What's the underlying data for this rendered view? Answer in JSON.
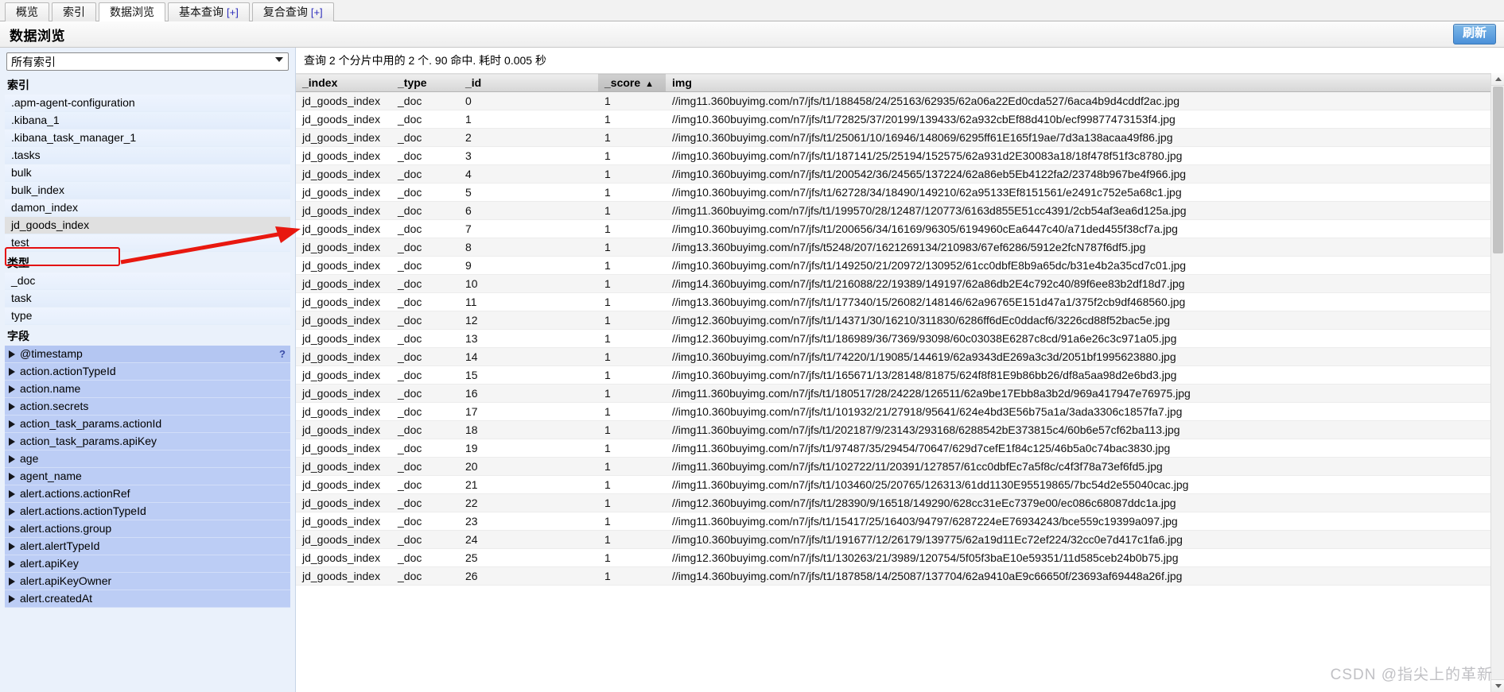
{
  "tabs": [
    {
      "label": "概览",
      "active": false,
      "plus": ""
    },
    {
      "label": "索引",
      "active": false,
      "plus": ""
    },
    {
      "label": "数据浏览",
      "active": true,
      "plus": ""
    },
    {
      "label": "基本查询",
      "active": false,
      "plus": "[+]"
    },
    {
      "label": "复合查询",
      "active": false,
      "plus": "[+]"
    }
  ],
  "header": {
    "title": "数据浏览",
    "refresh_label": "刷新"
  },
  "sidebar": {
    "index_select_value": "所有索引",
    "index_select_options": [
      "所有索引"
    ],
    "indices_title": "索引",
    "indices": [
      {
        "label": ".apm-agent-configuration",
        "selected": false
      },
      {
        "label": ".kibana_1",
        "selected": false
      },
      {
        "label": ".kibana_task_manager_1",
        "selected": false
      },
      {
        "label": ".tasks",
        "selected": false
      },
      {
        "label": "bulk",
        "selected": false
      },
      {
        "label": "bulk_index",
        "selected": false
      },
      {
        "label": "damon_index",
        "selected": false
      },
      {
        "label": "jd_goods_index",
        "selected": true
      },
      {
        "label": "test",
        "selected": false
      }
    ],
    "types_title": "类型",
    "types": [
      {
        "label": "_doc"
      },
      {
        "label": "task"
      },
      {
        "label": "type"
      }
    ],
    "fields_title": "字段",
    "fields": [
      {
        "label": "@timestamp",
        "help": "?"
      },
      {
        "label": "action.actionTypeId",
        "help": ""
      },
      {
        "label": "action.name",
        "help": ""
      },
      {
        "label": "action.secrets",
        "help": ""
      },
      {
        "label": "action_task_params.actionId",
        "help": ""
      },
      {
        "label": "action_task_params.apiKey",
        "help": ""
      },
      {
        "label": "age",
        "help": ""
      },
      {
        "label": "agent_name",
        "help": ""
      },
      {
        "label": "alert.actions.actionRef",
        "help": ""
      },
      {
        "label": "alert.actions.actionTypeId",
        "help": ""
      },
      {
        "label": "alert.actions.group",
        "help": ""
      },
      {
        "label": "alert.alertTypeId",
        "help": ""
      },
      {
        "label": "alert.apiKey",
        "help": ""
      },
      {
        "label": "alert.apiKeyOwner",
        "help": ""
      },
      {
        "label": "alert.createdAt",
        "help": ""
      }
    ]
  },
  "main": {
    "query_status": "查询 2 个分片中用的 2 个. 90 命中. 耗时 0.005 秒",
    "columns": [
      {
        "key": "_index",
        "label": "_index",
        "sorted": false,
        "sort_arrow": ""
      },
      {
        "key": "_type",
        "label": "_type",
        "sorted": false,
        "sort_arrow": ""
      },
      {
        "key": "_id",
        "label": "_id",
        "sorted": false,
        "sort_arrow": ""
      },
      {
        "key": "_score",
        "label": "_score",
        "sorted": true,
        "sort_arrow": "▲"
      },
      {
        "key": "img",
        "label": "img",
        "sorted": false,
        "sort_arrow": ""
      }
    ],
    "rows": [
      {
        "_index": "jd_goods_index",
        "_type": "_doc",
        "_id": "0",
        "_score": "1",
        "img": "//img11.360buyimg.com/n7/jfs/t1/188458/24/25163/62935/62a06a22Ed0cda527/6aca4b9d4cddf2ac.jpg"
      },
      {
        "_index": "jd_goods_index",
        "_type": "_doc",
        "_id": "1",
        "_score": "1",
        "img": "//img10.360buyimg.com/n7/jfs/t1/72825/37/20199/139433/62a932cbEf88d410b/ecf99877473153f4.jpg"
      },
      {
        "_index": "jd_goods_index",
        "_type": "_doc",
        "_id": "2",
        "_score": "1",
        "img": "//img10.360buyimg.com/n7/jfs/t1/25061/10/16946/148069/6295ff61E165f19ae/7d3a138acaa49f86.jpg"
      },
      {
        "_index": "jd_goods_index",
        "_type": "_doc",
        "_id": "3",
        "_score": "1",
        "img": "//img10.360buyimg.com/n7/jfs/t1/187141/25/25194/152575/62a931d2E30083a18/18f478f51f3c8780.jpg"
      },
      {
        "_index": "jd_goods_index",
        "_type": "_doc",
        "_id": "4",
        "_score": "1",
        "img": "//img10.360buyimg.com/n7/jfs/t1/200542/36/24565/137224/62a86eb5Eb4122fa2/23748b967be4f966.jpg"
      },
      {
        "_index": "jd_goods_index",
        "_type": "_doc",
        "_id": "5",
        "_score": "1",
        "img": "//img10.360buyimg.com/n7/jfs/t1/62728/34/18490/149210/62a95133Ef8151561/e2491c752e5a68c1.jpg"
      },
      {
        "_index": "jd_goods_index",
        "_type": "_doc",
        "_id": "6",
        "_score": "1",
        "img": "//img11.360buyimg.com/n7/jfs/t1/199570/28/12487/120773/6163d855E51cc4391/2cb54af3ea6d125a.jpg"
      },
      {
        "_index": "jd_goods_index",
        "_type": "_doc",
        "_id": "7",
        "_score": "1",
        "img": "//img10.360buyimg.com/n7/jfs/t1/200656/34/16169/96305/6194960cEa6447c40/a71ded455f38cf7a.jpg"
      },
      {
        "_index": "jd_goods_index",
        "_type": "_doc",
        "_id": "8",
        "_score": "1",
        "img": "//img13.360buyimg.com/n7/jfs/t5248/207/1621269134/210983/67ef6286/5912e2fcN787f6df5.jpg"
      },
      {
        "_index": "jd_goods_index",
        "_type": "_doc",
        "_id": "9",
        "_score": "1",
        "img": "//img10.360buyimg.com/n7/jfs/t1/149250/21/20972/130952/61cc0dbfE8b9a65dc/b31e4b2a35cd7c01.jpg"
      },
      {
        "_index": "jd_goods_index",
        "_type": "_doc",
        "_id": "10",
        "_score": "1",
        "img": "//img14.360buyimg.com/n7/jfs/t1/216088/22/19389/149197/62a86db2E4c792c40/89f6ee83b2df18d7.jpg"
      },
      {
        "_index": "jd_goods_index",
        "_type": "_doc",
        "_id": "11",
        "_score": "1",
        "img": "//img13.360buyimg.com/n7/jfs/t1/177340/15/26082/148146/62a96765E151d47a1/375f2cb9df468560.jpg"
      },
      {
        "_index": "jd_goods_index",
        "_type": "_doc",
        "_id": "12",
        "_score": "1",
        "img": "//img12.360buyimg.com/n7/jfs/t1/14371/30/16210/311830/6286ff6dEc0ddacf6/3226cd88f52bac5e.jpg"
      },
      {
        "_index": "jd_goods_index",
        "_type": "_doc",
        "_id": "13",
        "_score": "1",
        "img": "//img12.360buyimg.com/n7/jfs/t1/186989/36/7369/93098/60c03038E6287c8cd/91a6e26c3c971a05.jpg"
      },
      {
        "_index": "jd_goods_index",
        "_type": "_doc",
        "_id": "14",
        "_score": "1",
        "img": "//img10.360buyimg.com/n7/jfs/t1/74220/1/19085/144619/62a9343dE269a3c3d/2051bf1995623880.jpg"
      },
      {
        "_index": "jd_goods_index",
        "_type": "_doc",
        "_id": "15",
        "_score": "1",
        "img": "//img10.360buyimg.com/n7/jfs/t1/165671/13/28148/81875/624f8f81E9b86bb26/df8a5aa98d2e6bd3.jpg"
      },
      {
        "_index": "jd_goods_index",
        "_type": "_doc",
        "_id": "16",
        "_score": "1",
        "img": "//img11.360buyimg.com/n7/jfs/t1/180517/28/24228/126511/62a9be17Ebb8a3b2d/969a417947e76975.jpg"
      },
      {
        "_index": "jd_goods_index",
        "_type": "_doc",
        "_id": "17",
        "_score": "1",
        "img": "//img10.360buyimg.com/n7/jfs/t1/101932/21/27918/95641/624e4bd3E56b75a1a/3ada3306c1857fa7.jpg"
      },
      {
        "_index": "jd_goods_index",
        "_type": "_doc",
        "_id": "18",
        "_score": "1",
        "img": "//img11.360buyimg.com/n7/jfs/t1/202187/9/23143/293168/6288542bE373815c4/60b6e57cf62ba113.jpg"
      },
      {
        "_index": "jd_goods_index",
        "_type": "_doc",
        "_id": "19",
        "_score": "1",
        "img": "//img11.360buyimg.com/n7/jfs/t1/97487/35/29454/70647/629d7cefE1f84c125/46b5a0c74bac3830.jpg"
      },
      {
        "_index": "jd_goods_index",
        "_type": "_doc",
        "_id": "20",
        "_score": "1",
        "img": "//img11.360buyimg.com/n7/jfs/t1/102722/11/20391/127857/61cc0dbfEc7a5f8c/c4f3f78a73ef6fd5.jpg"
      },
      {
        "_index": "jd_goods_index",
        "_type": "_doc",
        "_id": "21",
        "_score": "1",
        "img": "//img11.360buyimg.com/n7/jfs/t1/103460/25/20765/126313/61dd1130E95519865/7bc54d2e55040cac.jpg"
      },
      {
        "_index": "jd_goods_index",
        "_type": "_doc",
        "_id": "22",
        "_score": "1",
        "img": "//img12.360buyimg.com/n7/jfs/t1/28390/9/16518/149290/628cc31eEc7379e00/ec086c68087ddc1a.jpg"
      },
      {
        "_index": "jd_goods_index",
        "_type": "_doc",
        "_id": "23",
        "_score": "1",
        "img": "//img11.360buyimg.com/n7/jfs/t1/15417/25/16403/94797/6287224eE76934243/bce559c19399a097.jpg"
      },
      {
        "_index": "jd_goods_index",
        "_type": "_doc",
        "_id": "24",
        "_score": "1",
        "img": "//img10.360buyimg.com/n7/jfs/t1/191677/12/26179/139775/62a19d11Ec72ef224/32cc0e7d417c1fa6.jpg"
      },
      {
        "_index": "jd_goods_index",
        "_type": "_doc",
        "_id": "25",
        "_score": "1",
        "img": "//img12.360buyimg.com/n7/jfs/t1/130263/21/3989/120754/5f05f3baE10e59351/11d585ceb24b0b75.jpg"
      },
      {
        "_index": "jd_goods_index",
        "_type": "_doc",
        "_id": "26",
        "_score": "1",
        "img": "//img14.360buyimg.com/n7/jfs/t1/187858/14/25087/137704/62a9410aE9c66650f/23693af69448a26f.jpg"
      }
    ]
  },
  "watermark": "CSDN @指尖上的革新"
}
